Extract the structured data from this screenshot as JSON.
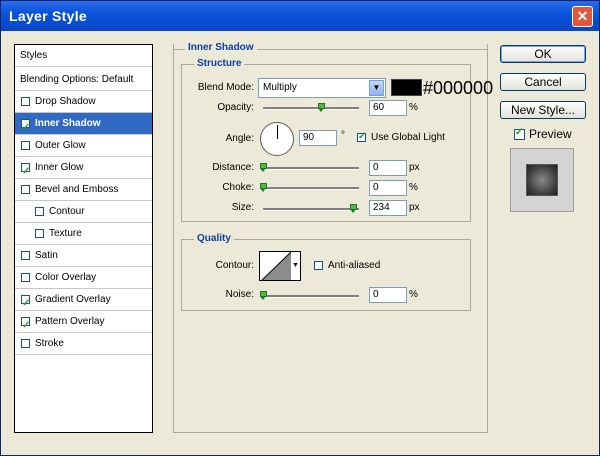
{
  "window": {
    "title": "Layer Style",
    "close_label": "✕"
  },
  "sidebar": {
    "header": "Styles",
    "blending": "Blending Options: Default",
    "items": [
      {
        "label": "Drop Shadow",
        "checked": false,
        "indent": false,
        "selected": false
      },
      {
        "label": "Inner Shadow",
        "checked": true,
        "indent": false,
        "selected": true
      },
      {
        "label": "Outer Glow",
        "checked": false,
        "indent": false,
        "selected": false
      },
      {
        "label": "Inner Glow",
        "checked": true,
        "indent": false,
        "selected": false
      },
      {
        "label": "Bevel and Emboss",
        "checked": false,
        "indent": false,
        "selected": false
      },
      {
        "label": "Contour",
        "checked": false,
        "indent": true,
        "selected": false
      },
      {
        "label": "Texture",
        "checked": false,
        "indent": true,
        "selected": false
      },
      {
        "label": "Satin",
        "checked": false,
        "indent": false,
        "selected": false
      },
      {
        "label": "Color Overlay",
        "checked": false,
        "indent": false,
        "selected": false
      },
      {
        "label": "Gradient Overlay",
        "checked": true,
        "indent": false,
        "selected": false
      },
      {
        "label": "Pattern Overlay",
        "checked": true,
        "indent": false,
        "selected": false
      },
      {
        "label": "Stroke",
        "checked": false,
        "indent": false,
        "selected": false
      }
    ]
  },
  "inner_shadow": {
    "section_title": "Inner Shadow",
    "structure_title": "Structure",
    "blend_mode_label": "Blend Mode:",
    "blend_mode_value": "Multiply",
    "color_hex": "#000000",
    "opacity_label": "Opacity:",
    "opacity_value": "60",
    "opacity_unit": "%",
    "opacity_fraction": 0.6,
    "angle_label": "Angle:",
    "angle_value": "90",
    "angle_unit": "°",
    "global_light_label": "Use Global Light",
    "global_light_checked": true,
    "distance_label": "Distance:",
    "distance_value": "0",
    "distance_unit": "px",
    "distance_fraction": 0,
    "choke_label": "Choke:",
    "choke_value": "0",
    "choke_unit": "%",
    "choke_fraction": 0,
    "size_label": "Size:",
    "size_value": "234",
    "size_unit": "px",
    "size_fraction": 0.94
  },
  "quality": {
    "title": "Quality",
    "contour_label": "Contour:",
    "anti_aliased_label": "Anti-aliased",
    "anti_aliased_checked": false,
    "noise_label": "Noise:",
    "noise_value": "0",
    "noise_unit": "%",
    "noise_fraction": 0
  },
  "buttons": {
    "ok": "OK",
    "cancel": "Cancel",
    "new_style": "New Style..."
  },
  "preview": {
    "label": "Preview",
    "checked": true
  },
  "colors": {
    "accent": "#316ac5",
    "section_title": "#0a3f9f",
    "slider_thumb": "#4ebb3b"
  }
}
